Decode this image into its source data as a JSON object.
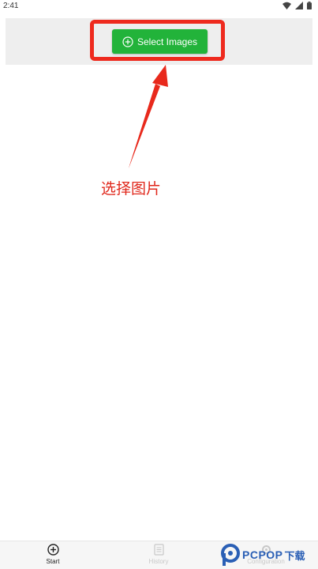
{
  "status_bar": {
    "time": "2:41"
  },
  "toolbar": {
    "select_images_label": "Select Images"
  },
  "annotation": {
    "text": "选择图片"
  },
  "bottom_nav": [
    {
      "label": "Start",
      "icon": "plus-circle-icon"
    },
    {
      "label": "History",
      "icon": "document-icon"
    },
    {
      "label": "Configuration",
      "icon": "gear-icon"
    }
  ],
  "watermark": {
    "brand": "PCPOP",
    "suffix": "下载"
  },
  "colors": {
    "button_green": "#22b33a",
    "highlight_red": "#ee2a1e",
    "brand_blue": "#2a5fb5"
  }
}
